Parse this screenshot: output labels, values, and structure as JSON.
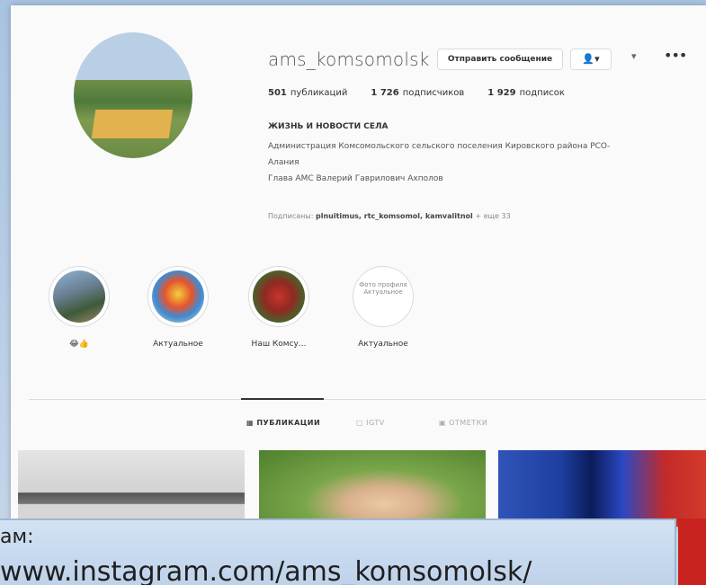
{
  "profile": {
    "username": "ams_komsomolsk",
    "message_button": "Отправить сообщение",
    "follow_icon": "person-icon",
    "more": "•••",
    "stats": [
      {
        "count": "501",
        "label": "публикаций"
      },
      {
        "count": "1 726",
        "label": "подписчиков"
      },
      {
        "count": "1 929",
        "label": "подписок"
      }
    ],
    "bio_title": "ЖИЗНЬ И НОВОСТИ СЕЛА",
    "bio_lines": [
      "Администрация Комсомольского сельского поселения Кировского района РСО-",
      "Алания",
      "Глава АМС Валерий Гаврилович Ахполов"
    ],
    "followed_by_prefix": "Подписаны:",
    "followed_by_names": "plnuitimus, rtc_komsomol, kamvalitnol",
    "followed_by_suffix": "+ еще 33"
  },
  "highlights": [
    {
      "label": "😂👍",
      "text": ""
    },
    {
      "label": "Актуальное",
      "text": ""
    },
    {
      "label": "Наш Комсу...",
      "text": ""
    },
    {
      "label": "Актуальное",
      "text": "Фото профиля Актуальное"
    }
  ],
  "tabs": [
    {
      "label": "ПУБЛИКАЦИИ"
    },
    {
      "label": "IGTV"
    },
    {
      "label": "ОТМЕТКИ"
    }
  ],
  "caption": {
    "line1": "ам:",
    "line2": "www.instagram.com/ams_komsomolsk/"
  },
  "colors": {
    "accent": "#3897f0",
    "text": "#262626",
    "caption_bg": "#c9dbef",
    "red": "#c8231e"
  }
}
